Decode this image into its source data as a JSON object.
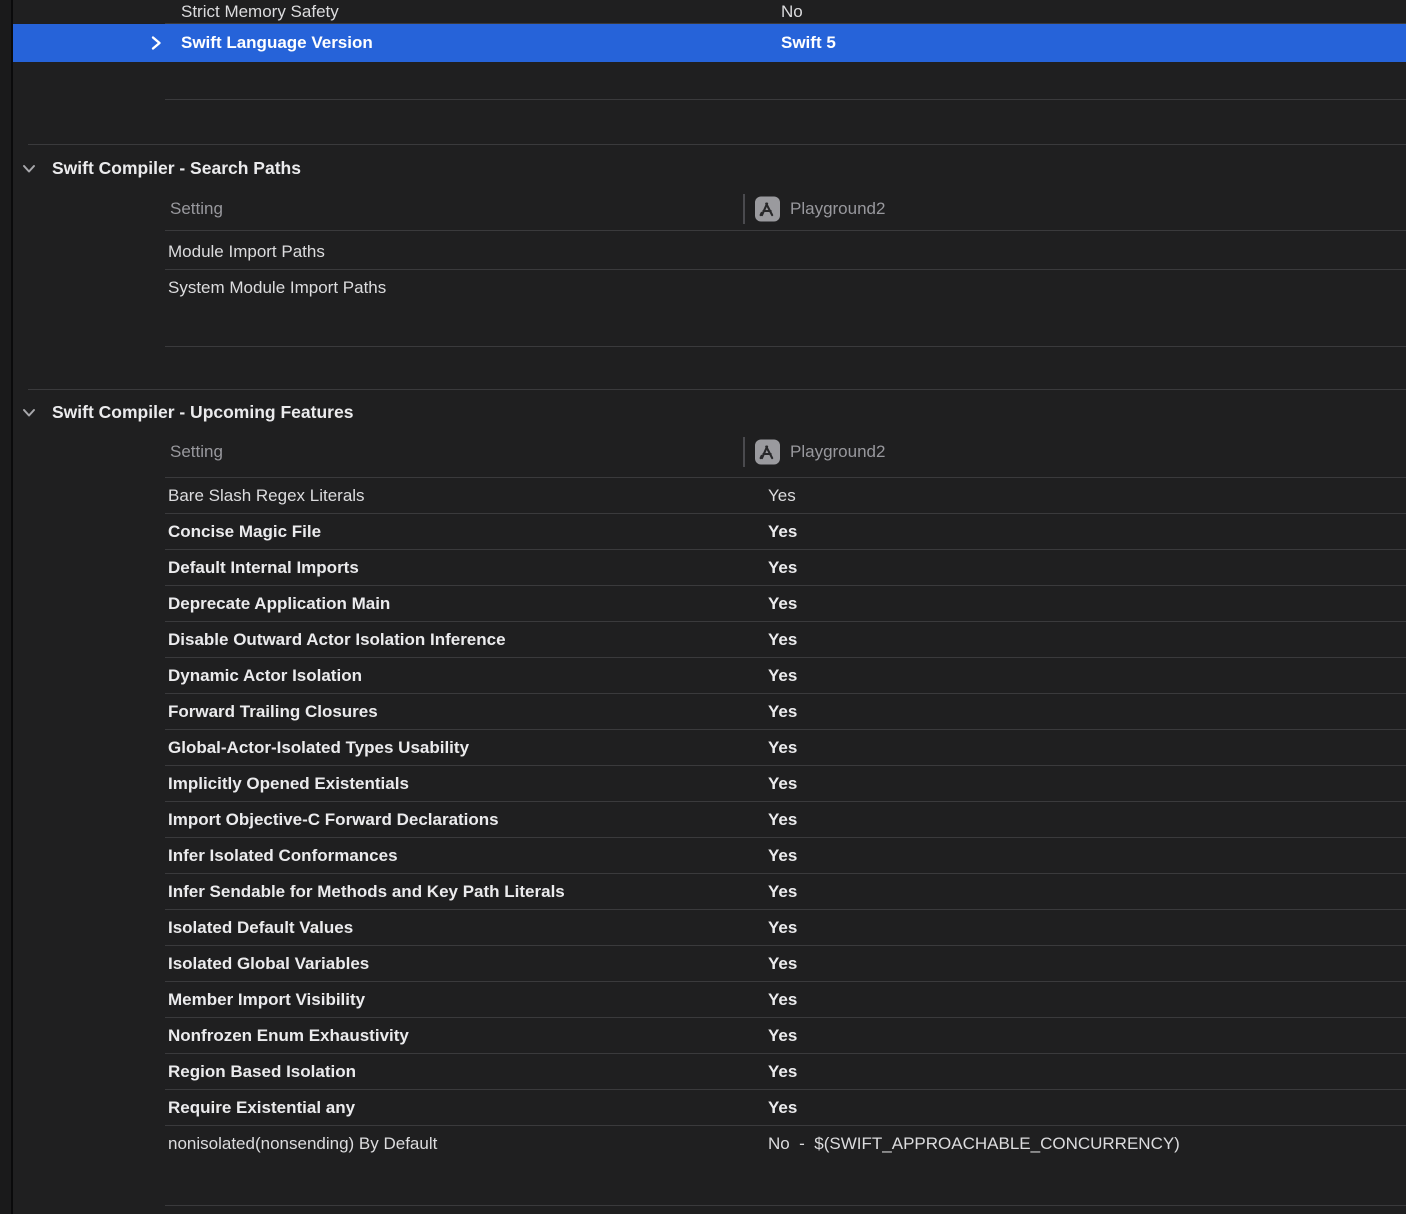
{
  "colors": {
    "background": "#1f1f20",
    "selection_blue": "#2663d9",
    "separator": "#3a3a3c",
    "muted_text": "#98989d",
    "icon_background": "#9a9a9e"
  },
  "pinned": {
    "strict_memory": {
      "label": "Strict Memory Safety",
      "value": "No"
    },
    "selected_row": {
      "label": "Swift Language Version",
      "value": "Swift 5"
    }
  },
  "icons": {
    "app_icon": "app-store-a-icon",
    "disclosure": "chevron-down-icon",
    "selected_chevron": "chevron-right-icon"
  },
  "sections": [
    {
      "title": "Swift Compiler - Search Paths",
      "header": {
        "setting": "Setting",
        "target": "Playground2"
      },
      "rows": [
        {
          "label": "Module Import Paths",
          "value": "",
          "bold": false
        },
        {
          "label": "System Module Import Paths",
          "value": "",
          "bold": false
        }
      ]
    },
    {
      "title": "Swift Compiler - Upcoming Features",
      "header": {
        "setting": "Setting",
        "target": "Playground2"
      },
      "rows": [
        {
          "label": "Bare Slash Regex Literals",
          "value": "Yes",
          "bold": false
        },
        {
          "label": "Concise Magic File",
          "value": "Yes",
          "bold": true
        },
        {
          "label": "Default Internal Imports",
          "value": "Yes",
          "bold": true
        },
        {
          "label": "Deprecate Application Main",
          "value": "Yes",
          "bold": true
        },
        {
          "label": "Disable Outward Actor Isolation Inference",
          "value": "Yes",
          "bold": true
        },
        {
          "label": "Dynamic Actor Isolation",
          "value": "Yes",
          "bold": true
        },
        {
          "label": "Forward Trailing Closures",
          "value": "Yes",
          "bold": true
        },
        {
          "label": "Global-Actor-Isolated Types Usability",
          "value": "Yes",
          "bold": true
        },
        {
          "label": "Implicitly Opened Existentials",
          "value": "Yes",
          "bold": true
        },
        {
          "label": "Import Objective-C Forward Declarations",
          "value": "Yes",
          "bold": true
        },
        {
          "label": "Infer Isolated Conformances",
          "value": "Yes",
          "bold": true
        },
        {
          "label": "Infer Sendable for Methods and Key Path Literals",
          "value": "Yes",
          "bold": true
        },
        {
          "label": "Isolated Default Values",
          "value": "Yes",
          "bold": true
        },
        {
          "label": "Isolated Global Variables",
          "value": "Yes",
          "bold": true
        },
        {
          "label": "Member Import Visibility",
          "value": "Yes",
          "bold": true
        },
        {
          "label": "Nonfrozen Enum Exhaustivity",
          "value": "Yes",
          "bold": true
        },
        {
          "label": "Region Based Isolation",
          "value": "Yes",
          "bold": true
        },
        {
          "label": "Require Existential any",
          "value": "Yes",
          "bold": true
        },
        {
          "label": "nonisolated(nonsending) By Default",
          "value": "No  -  $(SWIFT_APPROACHABLE_CONCURRENCY)",
          "bold": false
        }
      ]
    }
  ]
}
